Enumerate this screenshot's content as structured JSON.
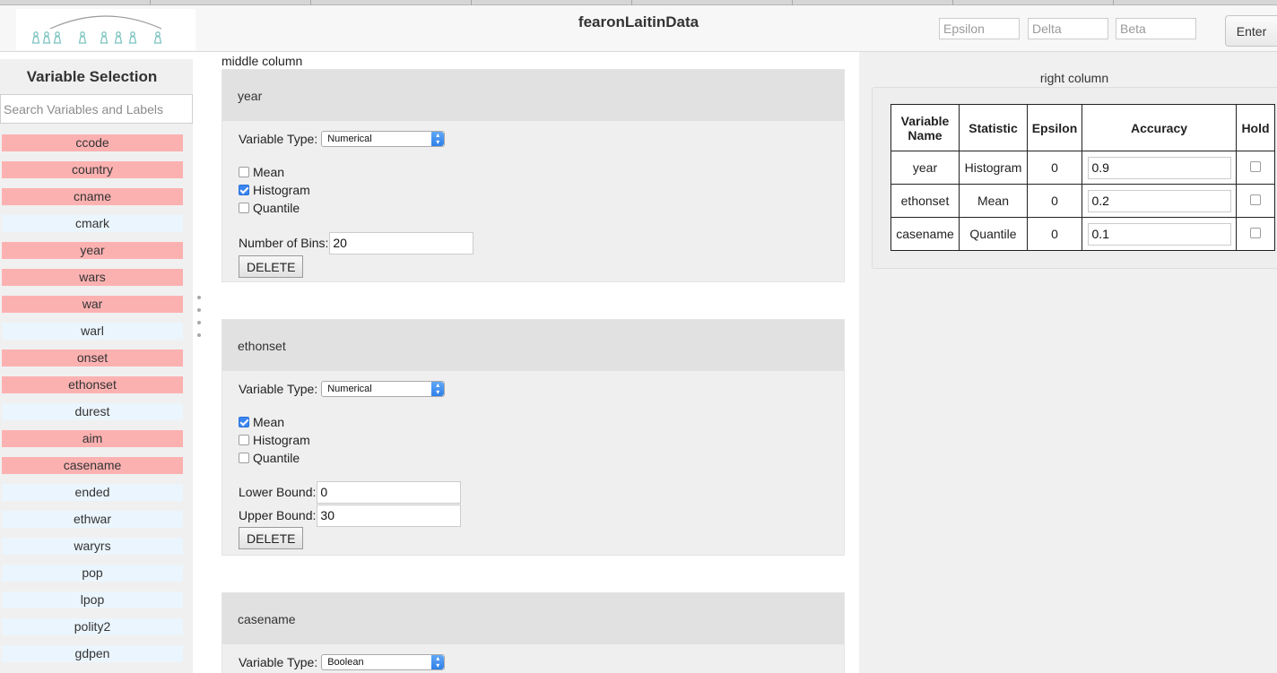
{
  "header": {
    "title": "fearonLaitinData",
    "epsilon_placeholder": "Epsilon",
    "delta_placeholder": "Delta",
    "beta_placeholder": "Beta",
    "enter_label": "Enter"
  },
  "colors": {
    "selected_variable": "#fcb1b1",
    "unselected_variable": "#ebf5fd",
    "checkbox_accent": "#3b85f0"
  },
  "left": {
    "title": "Variable Selection",
    "search_placeholder": "Search Variables and Labels",
    "variables": [
      {
        "name": "ccode",
        "selected": true
      },
      {
        "name": "country",
        "selected": true
      },
      {
        "name": "cname",
        "selected": true
      },
      {
        "name": "cmark",
        "selected": false
      },
      {
        "name": "year",
        "selected": true
      },
      {
        "name": "wars",
        "selected": true
      },
      {
        "name": "war",
        "selected": true
      },
      {
        "name": "warl",
        "selected": false
      },
      {
        "name": "onset",
        "selected": true
      },
      {
        "name": "ethonset",
        "selected": true
      },
      {
        "name": "durest",
        "selected": false
      },
      {
        "name": "aim",
        "selected": true
      },
      {
        "name": "casename",
        "selected": true
      },
      {
        "name": "ended",
        "selected": false
      },
      {
        "name": "ethwar",
        "selected": false
      },
      {
        "name": "waryrs",
        "selected": false
      },
      {
        "name": "pop",
        "selected": false
      },
      {
        "name": "lpop",
        "selected": false
      },
      {
        "name": "polity2",
        "selected": false
      },
      {
        "name": "gdpen",
        "selected": false
      }
    ]
  },
  "middle": {
    "title": "middle column",
    "cards": [
      {
        "name": "year",
        "type_label": "Variable Type:",
        "type_value": "Numerical",
        "mean_label": "Mean",
        "mean_checked": false,
        "histogram_label": "Histogram",
        "histogram_checked": true,
        "quantile_label": "Quantile",
        "quantile_checked": false,
        "bins_label": "Number of Bins:",
        "bins_value": "20",
        "delete_label": "DELETE"
      },
      {
        "name": "ethonset",
        "type_label": "Variable Type:",
        "type_value": "Numerical",
        "mean_label": "Mean",
        "mean_checked": true,
        "histogram_label": "Histogram",
        "histogram_checked": false,
        "quantile_label": "Quantile",
        "quantile_checked": false,
        "lower_label": "Lower Bound:",
        "lower_value": "0",
        "upper_label": "Upper Bound:",
        "upper_value": "30",
        "delete_label": "DELETE"
      },
      {
        "name": "casename",
        "type_label": "Variable Type:",
        "type_value": "Boolean"
      }
    ]
  },
  "right": {
    "title": "right column",
    "table": {
      "headers": [
        "Variable Name",
        "Statistic",
        "Epsilon",
        "Accuracy",
        "Hold"
      ],
      "rows": [
        {
          "variable": "year",
          "statistic": "Histogram",
          "epsilon": "0",
          "accuracy": "0.9",
          "hold": false
        },
        {
          "variable": "ethonset",
          "statistic": "Mean",
          "epsilon": "0",
          "accuracy": "0.2",
          "hold": false
        },
        {
          "variable": "casename",
          "statistic": "Quantile",
          "epsilon": "0",
          "accuracy": "0.1",
          "hold": false
        }
      ]
    }
  }
}
